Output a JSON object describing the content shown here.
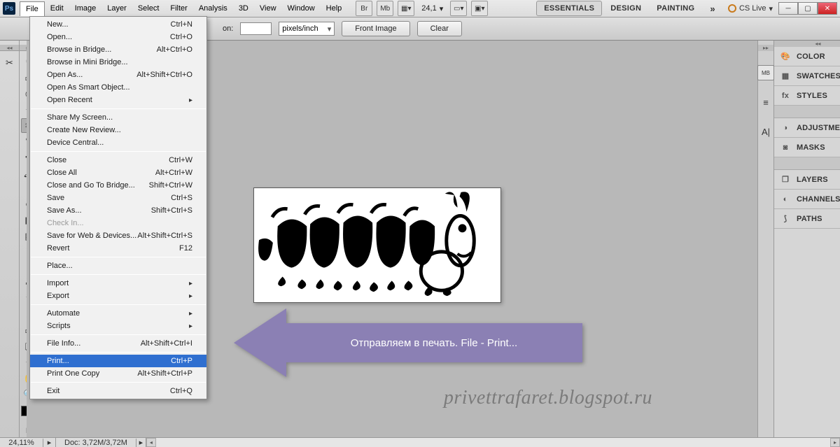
{
  "menubar": {
    "items": [
      "File",
      "Edit",
      "Image",
      "Layer",
      "Select",
      "Filter",
      "Analysis",
      "3D",
      "View",
      "Window",
      "Help"
    ],
    "zoom": "24,1",
    "workspaces": [
      "ESSENTIALS",
      "DESIGN",
      "PAINTING"
    ],
    "cslive": "CS Live"
  },
  "optionsbar": {
    "unit": "pixels/inch",
    "front_image": "Front Image",
    "clear": "Clear",
    "label_suffix": "on:"
  },
  "file_menu": [
    {
      "label": "New...",
      "sc": "Ctrl+N"
    },
    {
      "label": "Open...",
      "sc": "Ctrl+O"
    },
    {
      "label": "Browse in Bridge...",
      "sc": "Alt+Ctrl+O"
    },
    {
      "label": "Browse in Mini Bridge..."
    },
    {
      "label": "Open As...",
      "sc": "Alt+Shift+Ctrl+O"
    },
    {
      "label": "Open As Smart Object..."
    },
    {
      "label": "Open Recent",
      "sub": true
    },
    {
      "sep": true
    },
    {
      "label": "Share My Screen..."
    },
    {
      "label": "Create New Review..."
    },
    {
      "label": "Device Central..."
    },
    {
      "sep": true
    },
    {
      "label": "Close",
      "sc": "Ctrl+W"
    },
    {
      "label": "Close All",
      "sc": "Alt+Ctrl+W"
    },
    {
      "label": "Close and Go To Bridge...",
      "sc": "Shift+Ctrl+W"
    },
    {
      "label": "Save",
      "sc": "Ctrl+S"
    },
    {
      "label": "Save As...",
      "sc": "Shift+Ctrl+S"
    },
    {
      "label": "Check In...",
      "disabled": true
    },
    {
      "label": "Save for Web & Devices...",
      "sc": "Alt+Shift+Ctrl+S"
    },
    {
      "label": "Revert",
      "sc": "F12"
    },
    {
      "sep": true
    },
    {
      "label": "Place..."
    },
    {
      "sep": true
    },
    {
      "label": "Import",
      "sub": true
    },
    {
      "label": "Export",
      "sub": true
    },
    {
      "sep": true
    },
    {
      "label": "Automate",
      "sub": true
    },
    {
      "label": "Scripts",
      "sub": true
    },
    {
      "sep": true
    },
    {
      "label": "File Info...",
      "sc": "Alt+Shift+Ctrl+I"
    },
    {
      "sep": true
    },
    {
      "label": "Print...",
      "sc": "Ctrl+P",
      "hl": true
    },
    {
      "label": "Print One Copy",
      "sc": "Alt+Shift+Ctrl+P"
    },
    {
      "sep": true
    },
    {
      "label": "Exit",
      "sc": "Ctrl+Q"
    }
  ],
  "panels": {
    "color": "COLOR",
    "swatches": "SWATCHES",
    "styles": "STYLES",
    "adjustments": "ADJUSTMENTS",
    "masks": "MASKS",
    "layers": "LAYERS",
    "channels": "CHANNELS",
    "paths": "PATHS"
  },
  "annotation": "Отправляем в печать. File - Print...",
  "watermark": "privettrafaret.blogspot.ru",
  "status": {
    "zoom": "24,11%",
    "doc": "Doc: 3,72M/3,72M"
  }
}
